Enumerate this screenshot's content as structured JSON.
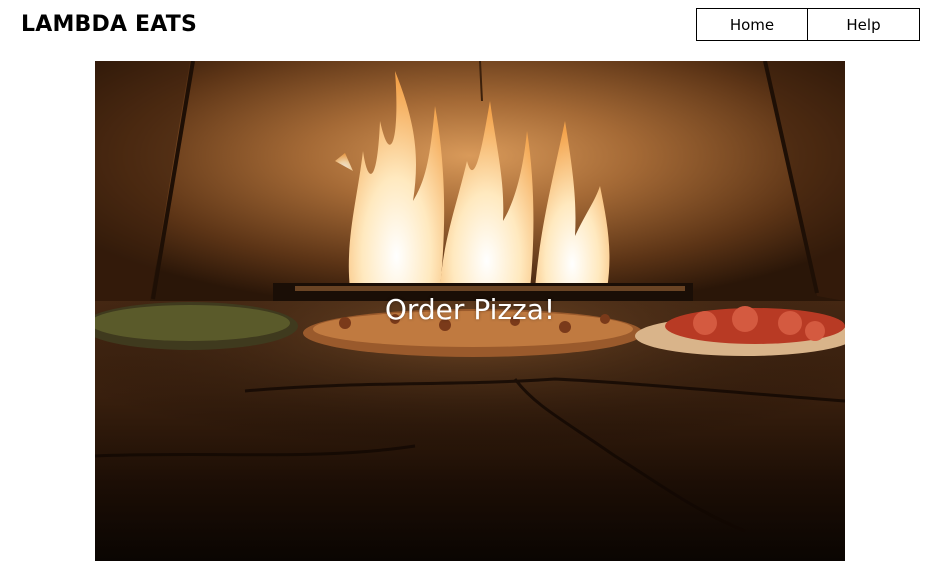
{
  "header": {
    "brand": "LAMBDA EATS",
    "nav": [
      {
        "label": "Home"
      },
      {
        "label": "Help"
      }
    ]
  },
  "hero": {
    "cta_label": "Order Pizza!",
    "image_subject": "pizzas in a wood-fired oven with flames",
    "colors": {
      "oven_wall": "#7a4a22",
      "flame": "#fff3d6",
      "floor": "#2a150a"
    }
  }
}
